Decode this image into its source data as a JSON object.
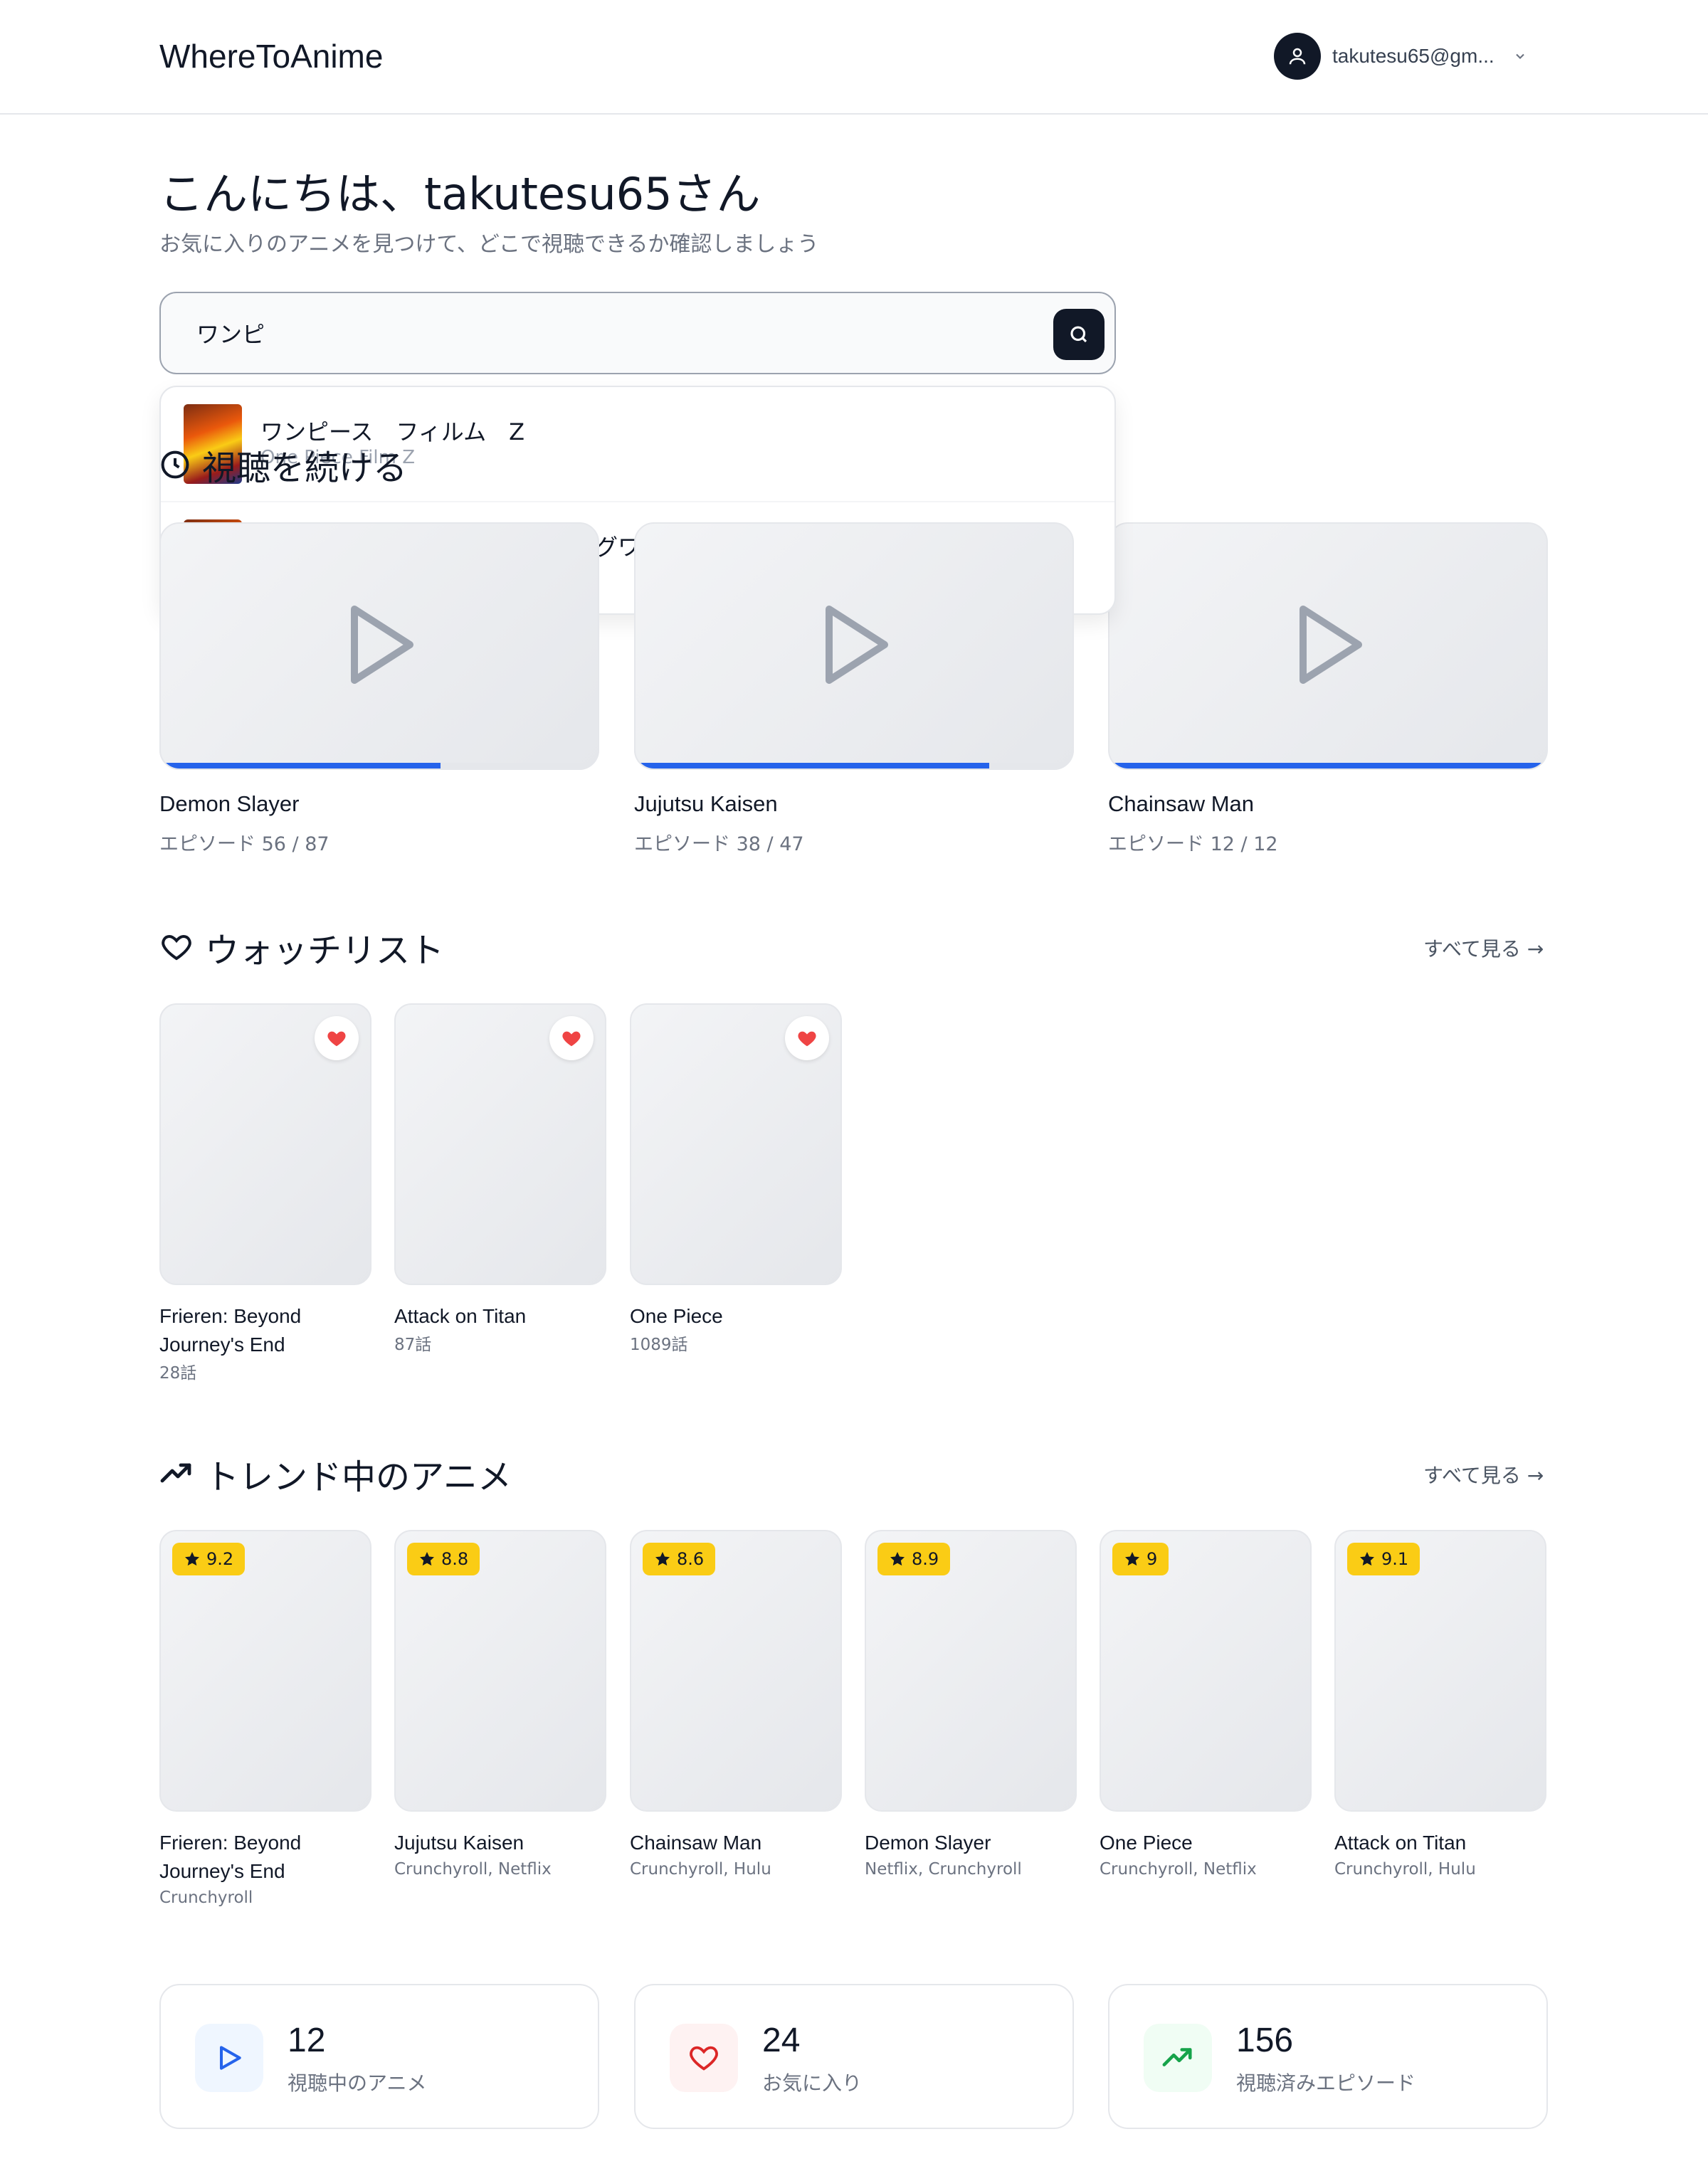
{
  "header": {
    "logo": "WhereToAnime",
    "user_email": "takutesu65@gm..."
  },
  "greeting": {
    "title": "こんにちは、takutesu65さん",
    "subtitle": "お気に入りのアニメを見つけて、どこで視聴できるか確認しましょう"
  },
  "search": {
    "value": "ワンピ",
    "results": [
      {
        "title": "ワンピース　フィルム　Z",
        "subtitle": "One Piece Film Z"
      },
      {
        "title": "グワ",
        "subtitle": ""
      }
    ]
  },
  "continue_watching": {
    "title": "視聴を続ける",
    "items": [
      {
        "title": "Demon Slayer",
        "episodes": "エピソード 56 / 87",
        "progress": 0.64
      },
      {
        "title": "Jujutsu Kaisen",
        "episodes": "エピソード 38 / 47",
        "progress": 0.81
      },
      {
        "title": "Chainsaw Man",
        "episodes": "エピソード 12 / 12",
        "progress": 1.0
      }
    ]
  },
  "watchlist": {
    "title": "ウォッチリスト",
    "see_all": "すべて見る →",
    "items": [
      {
        "title": "Frieren: Beyond Journey's End",
        "episodes": "28話"
      },
      {
        "title": "Attack on Titan",
        "episodes": "87話"
      },
      {
        "title": "One Piece",
        "episodes": "1089話"
      }
    ]
  },
  "trending": {
    "title": "トレンド中のアニメ",
    "see_all": "すべて見る →",
    "items": [
      {
        "title": "Frieren: Beyond Journey's End",
        "platforms": "Crunchyroll",
        "rating": "9.2"
      },
      {
        "title": "Jujutsu Kaisen",
        "platforms": "Crunchyroll, Netflix",
        "rating": "8.8"
      },
      {
        "title": "Chainsaw Man",
        "platforms": "Crunchyroll, Hulu",
        "rating": "8.6"
      },
      {
        "title": "Demon Slayer",
        "platforms": "Netflix, Crunchyroll",
        "rating": "8.9"
      },
      {
        "title": "One Piece",
        "platforms": "Crunchyroll, Netflix",
        "rating": "9"
      },
      {
        "title": "Attack on Titan",
        "platforms": "Crunchyroll, Hulu",
        "rating": "9.1"
      }
    ]
  },
  "stats": [
    {
      "value": "12",
      "label": "視聴中のアニメ",
      "icon": "play-icon",
      "color": "#2563eb",
      "bg": "#eff6ff"
    },
    {
      "value": "24",
      "label": "お気に入り",
      "icon": "heart-icon",
      "color": "#dc2626",
      "bg": "#fef2f2"
    },
    {
      "value": "156",
      "label": "視聴済みエピソード",
      "icon": "trending-up-icon",
      "color": "#16a34a",
      "bg": "#f0fdf4"
    }
  ],
  "colors": {
    "accent": "#2563eb",
    "dark": "#111827",
    "rating_badge": "#facc15",
    "heart": "#ef4444"
  }
}
